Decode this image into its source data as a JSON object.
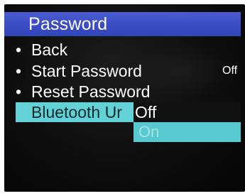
{
  "screen": {
    "title": "Password",
    "menu_items": [
      {
        "label": "Back",
        "value": ""
      },
      {
        "label": "Start Password",
        "value": "Off"
      },
      {
        "label": "Reset Password",
        "value": ""
      }
    ],
    "selected_item": {
      "label": "Bluetooth Ur"
    },
    "popup_options": [
      {
        "label": "Off",
        "state": "current"
      },
      {
        "label": "On",
        "state": "highlighted"
      }
    ],
    "bullet": "•"
  },
  "colors": {
    "title_bar": "#3b4cc4",
    "selection": "#63d2d6",
    "background": "#0d0d0d",
    "text": "#ffffff"
  }
}
